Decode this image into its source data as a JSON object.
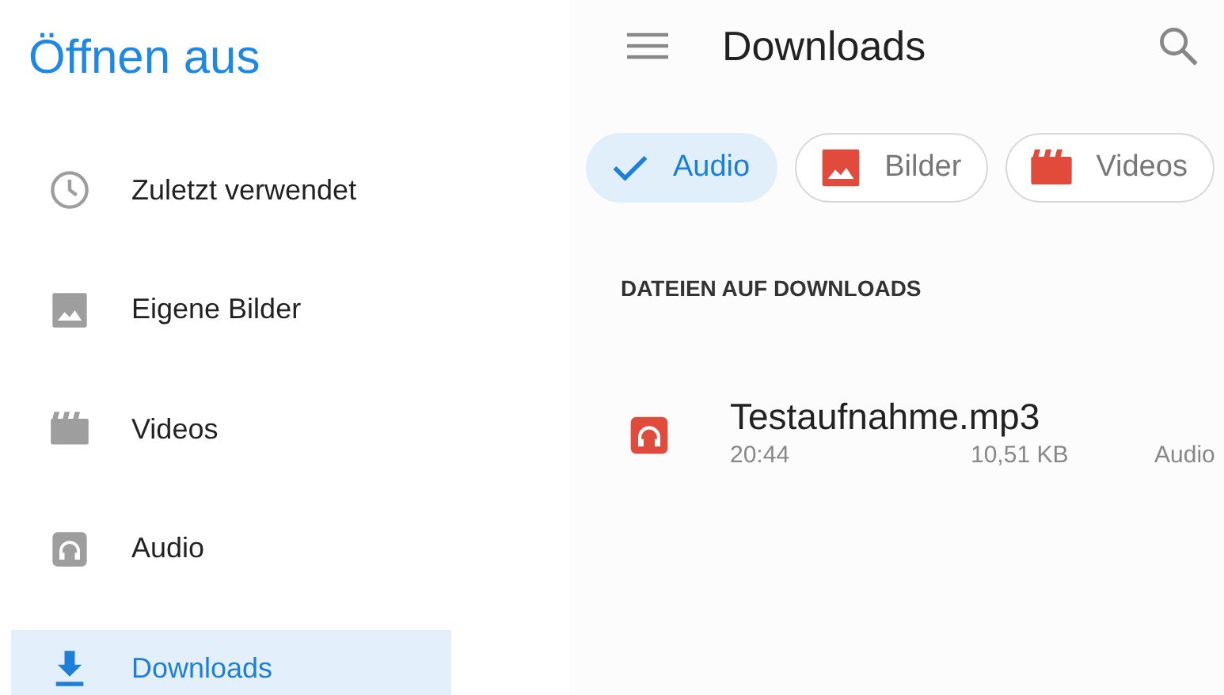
{
  "drawer": {
    "title": "Öffnen aus",
    "items": [
      {
        "label": "Zuletzt verwendet",
        "kind": "clock",
        "selected": false
      },
      {
        "label": "Eigene Bilder",
        "kind": "image",
        "selected": false
      },
      {
        "label": "Videos",
        "kind": "video",
        "selected": false
      },
      {
        "label": "Audio",
        "kind": "audio",
        "selected": false
      },
      {
        "label": "Downloads",
        "kind": "download",
        "selected": true
      }
    ]
  },
  "toolbar": {
    "title": "Downloads"
  },
  "filters": [
    {
      "label": "Audio",
      "kind": "audio",
      "selected": true
    },
    {
      "label": "Bilder",
      "kind": "image",
      "selected": false
    },
    {
      "label": "Videos",
      "kind": "video",
      "selected": false
    }
  ],
  "section": {
    "heading": "DATEIEN AUF DOWNLOADS",
    "files": [
      {
        "name": "Testaufnahme.mp3",
        "kind": "audio",
        "time": "20:44",
        "size": "10,51 KB",
        "type": "Audio"
      }
    ]
  }
}
